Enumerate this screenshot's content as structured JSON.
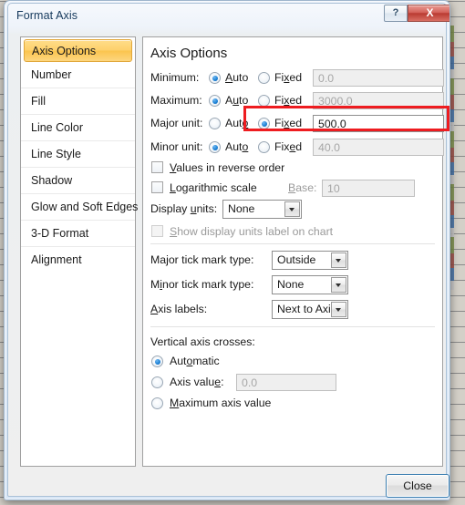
{
  "window": {
    "title": "Format Axis",
    "help_button": "?",
    "close_x_button": "X"
  },
  "sidebar": {
    "items": [
      {
        "label": "Axis Options",
        "selected": true
      },
      {
        "label": "Number",
        "selected": false
      },
      {
        "label": "Fill",
        "selected": false
      },
      {
        "label": "Line Color",
        "selected": false
      },
      {
        "label": "Line Style",
        "selected": false
      },
      {
        "label": "Shadow",
        "selected": false
      },
      {
        "label": "Glow and Soft Edges",
        "selected": false
      },
      {
        "label": "3-D Format",
        "selected": false
      },
      {
        "label": "Alignment",
        "selected": false
      }
    ]
  },
  "content": {
    "heading": "Axis Options",
    "scale_rows": [
      {
        "label": "Minimum:",
        "auto_label": "Auto",
        "fixed_label": "Fixed",
        "selected": "auto",
        "value": "0.0",
        "value_enabled": false
      },
      {
        "label": "Maximum:",
        "auto_label": "Auto",
        "fixed_label": "Fixed",
        "selected": "auto",
        "value": "3000.0",
        "value_enabled": false
      },
      {
        "label": "Major unit:",
        "auto_label": "Auto",
        "fixed_label": "Fixed",
        "selected": "fixed",
        "value": "500.0",
        "value_enabled": true
      },
      {
        "label": "Minor unit:",
        "auto_label": "Auto",
        "fixed_label": "Fixed",
        "selected": "auto",
        "value": "40.0",
        "value_enabled": false
      }
    ],
    "reverse_order": {
      "label": "Values in reverse order",
      "checked": false
    },
    "log_scale": {
      "label": "Logarithmic scale",
      "checked": false
    },
    "base": {
      "label": "Base:",
      "value": "10",
      "enabled": false
    },
    "display_units": {
      "label": "Display units:",
      "value": "None"
    },
    "show_units_label": {
      "label": "Show display units label on chart",
      "checked": false,
      "enabled": false
    },
    "major_tick": {
      "label": "Major tick mark type:",
      "value": "Outside"
    },
    "minor_tick": {
      "label": "Minor tick mark type:",
      "value": "None"
    },
    "axis_labels": {
      "label": "Axis labels:",
      "value": "Next to Axis"
    },
    "crosses": {
      "heading": "Vertical axis crosses:",
      "automatic": {
        "label": "Automatic",
        "selected": true
      },
      "axis_value": {
        "label": "Axis value:",
        "selected": false,
        "value": "0.0",
        "enabled": false
      },
      "maximum": {
        "label": "Maximum axis value",
        "selected": false
      }
    }
  },
  "footer": {
    "close_label": "Close"
  },
  "annotation": {
    "highlight_color": "#ee1c20",
    "highlight_target": "major-unit-fixed-row"
  }
}
